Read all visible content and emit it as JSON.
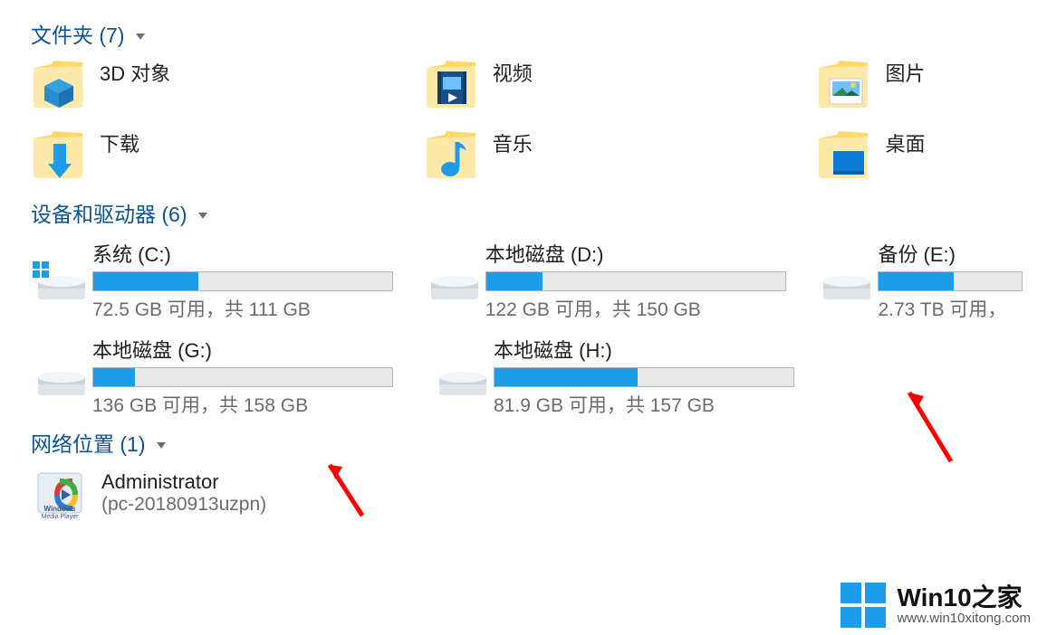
{
  "sections": {
    "folders_header": "文件夹 (7)",
    "drives_header": "设备和驱动器 (6)",
    "network_header": "网络位置 (1)"
  },
  "folders": [
    {
      "label": "3D 对象",
      "icon": "3d-objects"
    },
    {
      "label": "视频",
      "icon": "videos"
    },
    {
      "label": "图片",
      "icon": "pictures"
    },
    {
      "label": "下载",
      "icon": "downloads"
    },
    {
      "label": "音乐",
      "icon": "music"
    },
    {
      "label": "桌面",
      "icon": "desktop"
    }
  ],
  "drives": [
    {
      "name": "系统 (C:)",
      "status": "72.5 GB 可用，共 111 GB",
      "fill_pct": 35,
      "os": true
    },
    {
      "name": "本地磁盘 (D:)",
      "status": "122 GB 可用，共 150 GB",
      "fill_pct": 19,
      "os": false
    },
    {
      "name": "备份 (E:)",
      "status": "2.73 TB 可用，",
      "fill_pct": 52,
      "os": false
    },
    {
      "name": "本地磁盘 (G:)",
      "status": "136 GB 可用，共 158 GB",
      "fill_pct": 14,
      "os": false
    },
    {
      "name": "本地磁盘 (H:)",
      "status": "81.9 GB 可用，共 157 GB",
      "fill_pct": 48,
      "os": false
    }
  ],
  "network": {
    "name": "Administrator",
    "sub": "(pc-20180913uzpn)"
  },
  "watermark": {
    "title": "Win10之家",
    "url": "www.win10xitong.com"
  }
}
